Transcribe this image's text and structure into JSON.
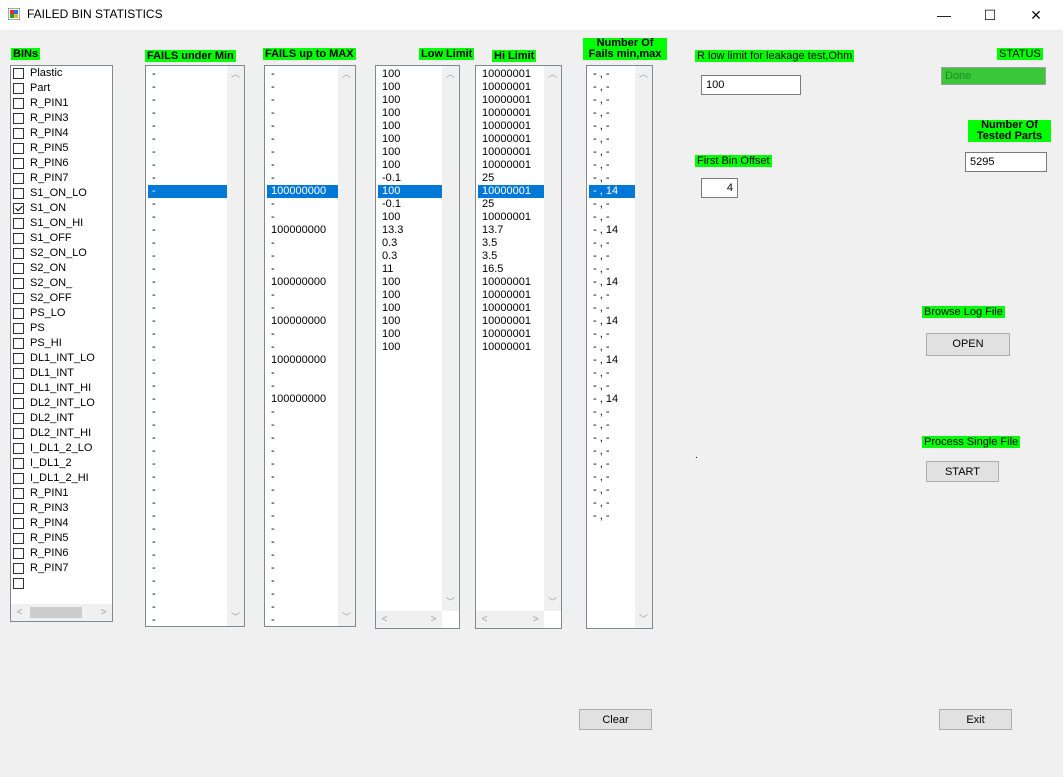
{
  "window": {
    "title": "FAILED BIN STATISTICS",
    "minimize": "—",
    "maximize": "☐",
    "close": "✕"
  },
  "labels": {
    "bins": "BINs",
    "fails_under_min": "FAILS under Min",
    "fails_up_to_max": "FAILS up to MAX",
    "low_limit": "Low Limit",
    "hi_limit": "Hi Limit",
    "num_fails": "Number Of Fails min,max",
    "r_low": "R low  limit for leakage test,Ohm",
    "status": "STATUS",
    "num_tested": "Number Of Tested Parts",
    "first_bin_offset": "First Bin Offset",
    "browse_log": "Browse Log File",
    "process_single": "Process Single File"
  },
  "inputs": {
    "r_low": "100",
    "status": "Done",
    "num_tested": "5295",
    "first_bin_offset": "4"
  },
  "buttons": {
    "open": "OPEN",
    "start": "START",
    "clear": "Clear",
    "exit": "Exit"
  },
  "stray_dot": ".",
  "bins": [
    {
      "label": "Plastic",
      "checked": false
    },
    {
      "label": "Part",
      "checked": false
    },
    {
      "label": "R_PIN1",
      "checked": false
    },
    {
      "label": "R_PIN3",
      "checked": false
    },
    {
      "label": "R_PIN4",
      "checked": false
    },
    {
      "label": "R_PIN5",
      "checked": false
    },
    {
      "label": "R_PIN6",
      "checked": false
    },
    {
      "label": "R_PIN7",
      "checked": false
    },
    {
      "label": "S1_ON_LO",
      "checked": false
    },
    {
      "label": "S1_ON",
      "checked": true
    },
    {
      "label": "S1_ON_HI",
      "checked": false
    },
    {
      "label": "S1_OFF",
      "checked": false
    },
    {
      "label": "S2_ON_LO",
      "checked": false
    },
    {
      "label": "S2_ON",
      "checked": false
    },
    {
      "label": "S2_ON_",
      "checked": false
    },
    {
      "label": "S2_OFF",
      "checked": false
    },
    {
      "label": "PS_LO",
      "checked": false
    },
    {
      "label": "PS",
      "checked": false
    },
    {
      "label": "PS_HI",
      "checked": false
    },
    {
      "label": "DL1_INT_LO",
      "checked": false
    },
    {
      "label": "DL1_INT",
      "checked": false
    },
    {
      "label": "DL1_INT_HI",
      "checked": false
    },
    {
      "label": "DL2_INT_LO",
      "checked": false
    },
    {
      "label": "DL2_INT",
      "checked": false
    },
    {
      "label": "DL2_INT_HI",
      "checked": false
    },
    {
      "label": "I_DL1_2_LO",
      "checked": false
    },
    {
      "label": "I_DL1_2",
      "checked": false
    },
    {
      "label": "I_DL1_2_HI",
      "checked": false
    },
    {
      "label": "R_PIN1",
      "checked": false
    },
    {
      "label": "R_PIN3",
      "checked": false
    },
    {
      "label": "R_PIN4",
      "checked": false
    },
    {
      "label": "R_PIN5",
      "checked": false
    },
    {
      "label": "R_PIN6",
      "checked": false
    },
    {
      "label": "R_PIN7",
      "checked": false
    },
    {
      "label": "",
      "checked": false
    }
  ],
  "lists": {
    "fails_under_min": {
      "selected": 9,
      "items": [
        "-",
        "-",
        "-",
        "-",
        "-",
        "-",
        "-",
        "-",
        "-",
        "-",
        "-",
        "-",
        "-",
        "-",
        "-",
        "-",
        "-",
        "-",
        "-",
        "-",
        "-",
        "-",
        "-",
        "-",
        "-",
        "-",
        "-",
        "-",
        "-",
        "-",
        "-",
        "-",
        "-",
        "-",
        "-",
        "-",
        "-",
        "-",
        "-",
        "-",
        "-",
        "-",
        "-",
        "-",
        "-"
      ]
    },
    "fails_up_to_max": {
      "selected": 9,
      "items": [
        "-",
        "-",
        "-",
        "-",
        "-",
        "-",
        "-",
        "-",
        "-",
        "100000000",
        "-",
        "-",
        "100000000",
        "-",
        "-",
        "-",
        "100000000",
        "-",
        "-",
        "100000000",
        "-",
        "-",
        "100000000",
        "-",
        "-",
        "100000000",
        "-",
        "-",
        "-",
        "-",
        "-",
        "-",
        "-",
        "-",
        "-",
        "-",
        "-",
        "-",
        "-",
        "-",
        "-",
        "-",
        "-",
        "-",
        "-"
      ]
    },
    "low_limit": {
      "selected": 9,
      "items": [
        "100",
        "100",
        "100",
        "100",
        "100",
        "100",
        "100",
        "100",
        "-0.1",
        "100",
        "-0.1",
        "100",
        "13.3",
        "0.3",
        "0.3",
        "11",
        "100",
        "100",
        "100",
        "100",
        "100",
        "100"
      ]
    },
    "hi_limit": {
      "selected": 9,
      "items": [
        "10000001",
        "10000001",
        "10000001",
        "10000001",
        "10000001",
        "10000001",
        "10000001",
        "10000001",
        "25",
        "10000001",
        "25",
        "10000001",
        "13.7",
        "3.5",
        "3.5",
        "16.5",
        "10000001",
        "10000001",
        "10000001",
        "10000001",
        "10000001",
        "10000001"
      ]
    },
    "num_fails": {
      "selected": 9,
      "items": [
        "- , -",
        "- , -",
        "- , -",
        "- , -",
        "- , -",
        "- , -",
        "- , -",
        "- , -",
        "- , -",
        "- , 14",
        "- , -",
        "- , -",
        "- , 14",
        "- , -",
        "- , -",
        "- , -",
        "- , 14",
        "- , -",
        "- , -",
        "- , 14",
        "- , -",
        "- , -",
        "- , 14",
        "- , -",
        "- , -",
        "- , 14",
        "- , -",
        "- , -",
        "- , -",
        "- , -",
        "- , -",
        "- , -",
        "- , -",
        "- , -",
        "- , -"
      ]
    }
  }
}
